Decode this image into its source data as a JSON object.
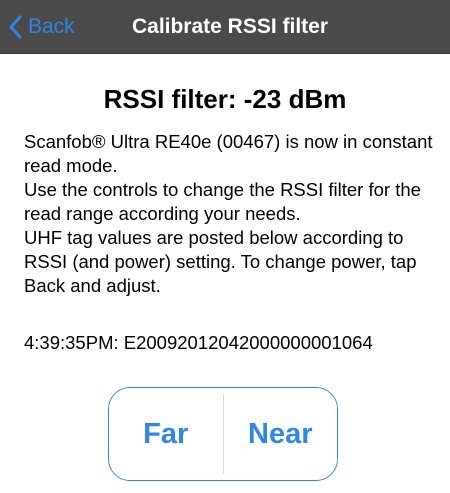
{
  "nav": {
    "back_label": "Back",
    "title": "Calibrate RSSI filter"
  },
  "filter": {
    "heading": "RSSI filter: -23 dBm"
  },
  "description": {
    "line1": "Scanfob® Ultra RE40e (00467) is now in constant read mode.",
    "line2": "Use the controls to change the RSSI filter for the read range according your needs.",
    "line3": "UHF tag values are posted below according to RSSI (and power) setting. To change power, tap Back and adjust."
  },
  "tag_reading": {
    "text": "4:39:35PM: E2009201204200000000​1064"
  },
  "controls": {
    "far_label": "Far",
    "near_label": "Near"
  },
  "colors": {
    "accent": "#2f86e6",
    "nav_background": "#4a4a4a"
  },
  "icons": {
    "back": "chevron-left-icon"
  }
}
